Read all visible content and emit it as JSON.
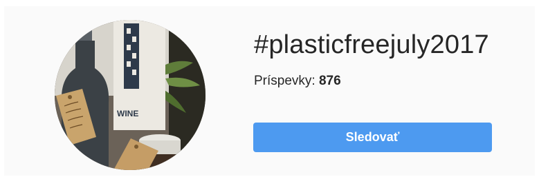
{
  "profile": {
    "hashtag": "#plasticfreejuly2017",
    "posts_label": "Príspevky:",
    "posts_count": "876",
    "follow_label": "Sledovať"
  },
  "photo": {
    "bottle_label": "WINE"
  }
}
